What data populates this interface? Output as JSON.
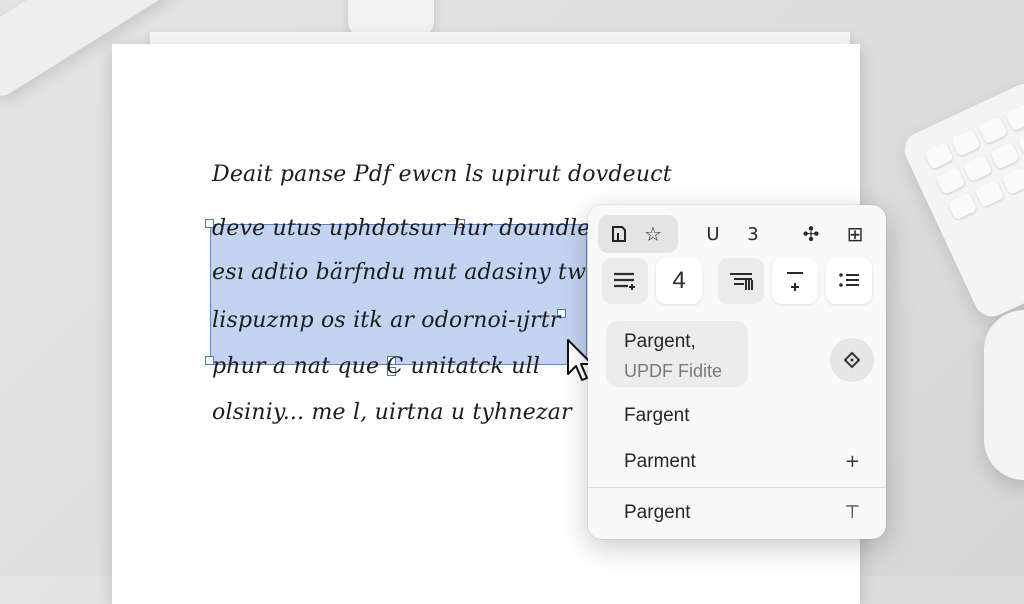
{
  "document": {
    "lines": [
      "Deait panse Pdf ewcn ls upirut dovdeuct",
      "deve utus uphdotsur hur doundle",
      "esı adtio bärfndu mut adasiny tw",
      "lispuzmp os itk ar odornoi-ıjrtr",
      "phur a nat que C unitatck ull",
      "olsiniy... me l, uirtna u tyhnezar"
    ]
  },
  "popup": {
    "toolbar_row1": [
      {
        "icon": "select-tool-icon",
        "glyph": "⬚"
      },
      {
        "icon": "star-icon",
        "glyph": "☆"
      },
      {
        "icon": "underline-icon",
        "glyph": "U"
      },
      {
        "icon": "number-three-icon",
        "glyph": "3"
      },
      {
        "icon": "grid-icon",
        "glyph": "✣"
      },
      {
        "icon": "table-icon",
        "glyph": "⊞"
      }
    ],
    "toolbar_row2": [
      {
        "icon": "align-left-icon"
      },
      {
        "icon": "text-size-icon",
        "glyph": "4"
      },
      {
        "icon": "align-right-icon"
      },
      {
        "icon": "line-spacing-icon"
      },
      {
        "icon": "bullet-list-icon"
      }
    ],
    "card": {
      "title": "Pargent,",
      "subtitle": "UPDF Fidite"
    },
    "round_button_icon": "diamond-icon",
    "items": [
      {
        "label": "Fargent",
        "arrow": ""
      },
      {
        "label": "Parment",
        "arrow": "+"
      },
      {
        "label": "Pargent",
        "arrow": "⊤"
      }
    ]
  }
}
